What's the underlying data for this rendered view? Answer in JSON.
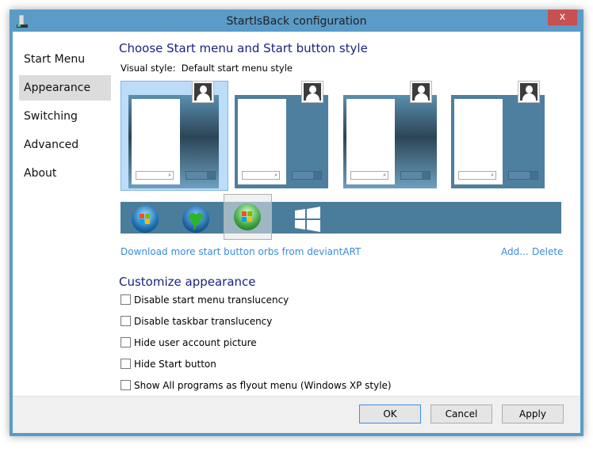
{
  "window": {
    "title": "StartIsBack configuration",
    "close_glyph": "x"
  },
  "sidebar": {
    "items": [
      {
        "label": "Start Menu",
        "selected": false
      },
      {
        "label": "Appearance",
        "selected": true
      },
      {
        "label": "Switching",
        "selected": false
      },
      {
        "label": "Advanced",
        "selected": false
      },
      {
        "label": "About",
        "selected": false
      }
    ]
  },
  "main": {
    "heading": "Choose Start menu and Start button style",
    "visual_style_label": "Visual style:",
    "visual_style_value": "Default start menu style",
    "styles_selected_index": 0,
    "orbs": [
      "windows7-orb",
      "shamrock-orb",
      "windows-vista-orb",
      "windows8-logo"
    ],
    "orb_selected_index": 2,
    "download_link": "Download more start button orbs from deviantART",
    "add_link": "Add...",
    "delete_link": "Delete",
    "customize_heading": "Customize appearance",
    "options": [
      {
        "label": "Disable start menu translucency",
        "checked": false
      },
      {
        "label": "Disable taskbar translucency",
        "checked": false
      },
      {
        "label": "Hide user account picture",
        "checked": false
      },
      {
        "label": "Hide Start button",
        "checked": false
      },
      {
        "label": "Show All programs as flyout menu (Windows XP style)",
        "checked": false
      }
    ]
  },
  "footer": {
    "ok": "OK",
    "cancel": "Cancel",
    "apply": "Apply"
  },
  "colors": {
    "accent": "#5a9bc8",
    "heading": "#1a237e",
    "link": "#3a8be0",
    "close": "#c75050"
  }
}
